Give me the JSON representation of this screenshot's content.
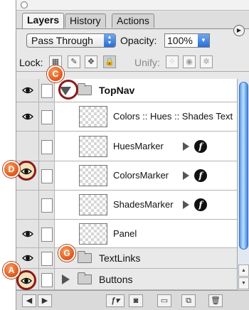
{
  "tabs": [
    {
      "label": "Layers",
      "active": true
    },
    {
      "label": "History",
      "active": false
    },
    {
      "label": "Actions",
      "active": false
    }
  ],
  "blend": {
    "mode": "Pass Through",
    "opacity_label": "Opacity:",
    "opacity_value": "100%"
  },
  "lock": {
    "label": "Lock:",
    "unify_label": "Unify:"
  },
  "layers": [
    {
      "name": "TopNav",
      "kind": "group",
      "visible": true,
      "selected": true,
      "expanded": true
    },
    {
      "name": "Colors :: Hues :: Shades Text",
      "kind": "layer",
      "visible": true,
      "effects": false
    },
    {
      "name": "HuesMarker",
      "kind": "layer",
      "visible": false,
      "effects": true
    },
    {
      "name": "ColorsMarker",
      "kind": "layer",
      "visible": true,
      "effects": true
    },
    {
      "name": "ShadesMarker",
      "kind": "layer",
      "visible": false,
      "effects": true
    },
    {
      "name": "Panel",
      "kind": "layer",
      "visible": true,
      "effects": false
    },
    {
      "name": "TextLinks",
      "kind": "group",
      "visible": true,
      "expanded": false
    },
    {
      "name": "Buttons",
      "kind": "group",
      "visible": true,
      "expanded": false
    }
  ],
  "effects_glyph": "f",
  "callouts": {
    "a": "A",
    "c": "C",
    "d": "D",
    "g": "G"
  },
  "colors": {
    "callout": "#e0541a",
    "ring": "#8c1a1a",
    "scroll_thumb": "#5a9be6"
  }
}
